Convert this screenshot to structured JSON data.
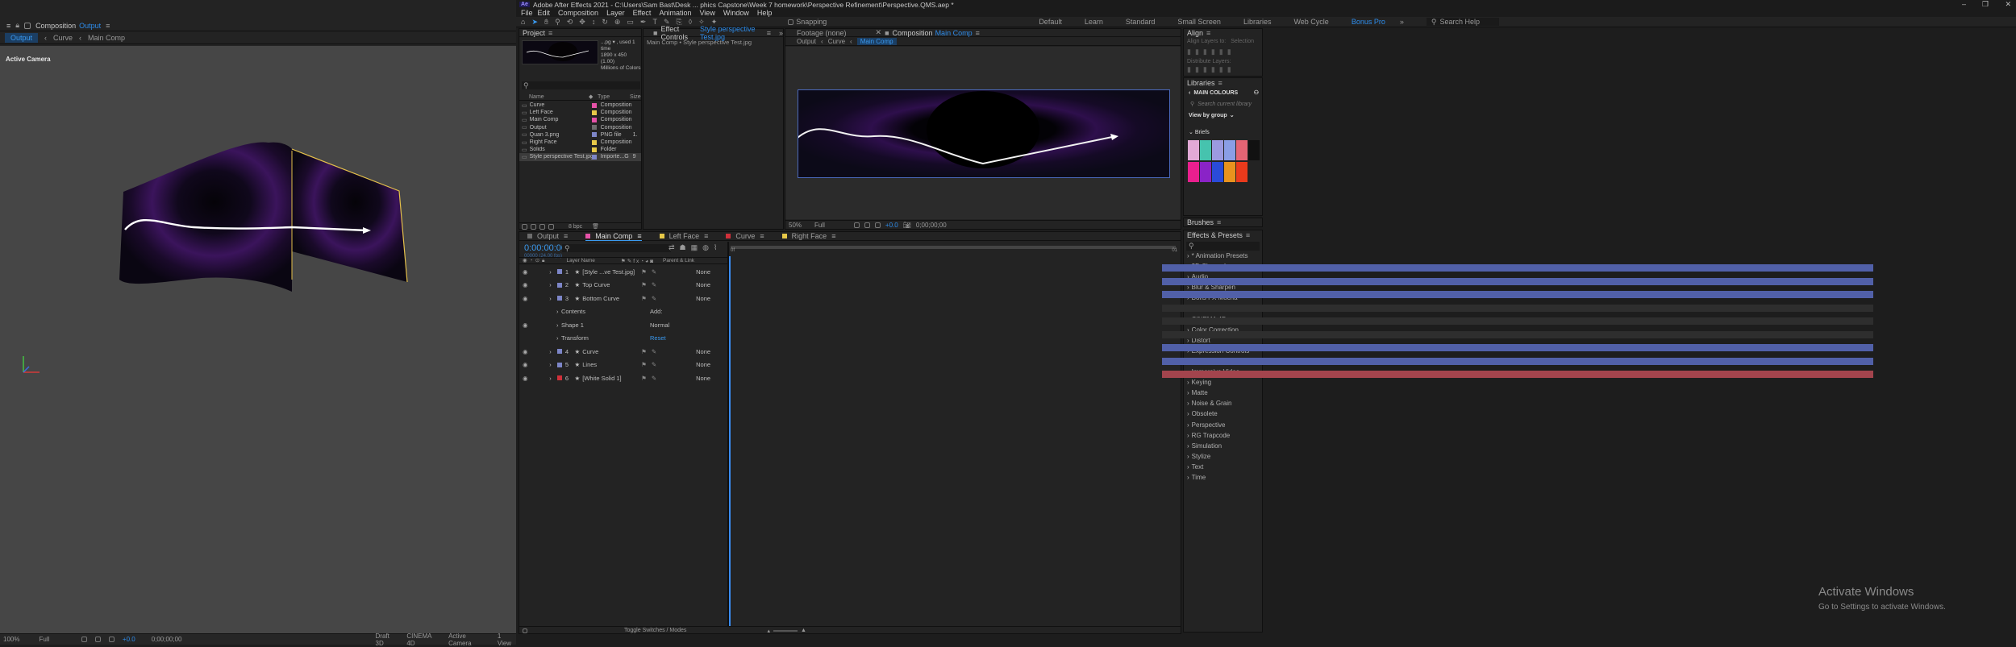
{
  "left_viewer": {
    "title": "Composition",
    "active": "Output",
    "tabs": [
      "Output",
      "Curve",
      "Main Comp"
    ],
    "camera_label": "Active Camera",
    "status": {
      "zoom": "100%",
      "quality": "Full",
      "exposure": "+0.0",
      "timecode": "0;00;00;00",
      "renderer": "Draft 3D",
      "engine": "CINEMA 4D",
      "camera": "Active Camera",
      "views": "1 View"
    }
  },
  "app": {
    "logo": "Ae",
    "title": "Adobe After Effects 2021 - C:\\Users\\Sam Bast\\Desk ... phics Capstone\\Week 7 homework\\Perspective Refinement\\Perspective.QMS.aep *"
  },
  "menu": [
    "File",
    "Edit",
    "Composition",
    "Layer",
    "Effect",
    "Animation",
    "View",
    "Window",
    "Help"
  ],
  "toolbar": {
    "snapping": "Snapping",
    "workspaces": [
      "Default",
      "Learn",
      "Standard",
      "Small Screen",
      "Libraries",
      "Web Cycle",
      "Bonus Pro"
    ],
    "search": "Search Help"
  },
  "project": {
    "tab": "Project",
    "preview_info": [
      "...pg ▾ , used 1 time",
      "1890 x 450 (1.00)",
      "",
      "Millions of Colors"
    ],
    "headers": [
      "Name",
      "Type",
      "Size"
    ],
    "items": [
      {
        "name": "Curve",
        "type": "Composition",
        "size": "",
        "color": "#e652a8"
      },
      {
        "name": "Left Face",
        "type": "Composition",
        "size": "",
        "color": "#e6c848"
      },
      {
        "name": "Main Comp",
        "type": "Composition",
        "size": "",
        "color": "#e652a8"
      },
      {
        "name": "Output",
        "type": "Composition",
        "size": "",
        "color": "#6d6d6d"
      },
      {
        "name": "Quan 3.png",
        "type": "PNG file",
        "size": "1.",
        "color": "#7d86c8"
      },
      {
        "name": "Right Face",
        "type": "Composition",
        "size": "",
        "color": "#e6c848"
      },
      {
        "name": "Solids",
        "type": "Folder",
        "size": "",
        "color": "#e6c848"
      },
      {
        "name": "Style perspective Test.jpg",
        "type": "Importe...G",
        "size": "9",
        "color": "#7d86c8"
      }
    ],
    "footer": "8 bpc"
  },
  "effect_controls": {
    "tab": "Effect Controls",
    "file": "Style perspective Test.jpg",
    "sub": "Main Comp • Style perspective Test.jpg"
  },
  "comp_viewer": {
    "footage_tab": "Footage (none)",
    "comp_tab": "Composition",
    "comp_name": "Main Comp",
    "crumbs": [
      "Output",
      "Curve",
      "Main Comp"
    ],
    "zoom": "50%",
    "quality": "Full",
    "exposure": "+0.0",
    "timecode": "0;00;00;00"
  },
  "align": {
    "title": "Align",
    "align_layers": "Align Layers to:",
    "selection": "Selection",
    "distribute": "Distribute Layers:"
  },
  "libraries": {
    "title": "Libraries",
    "library": "MAIN COLOURS",
    "search": "Search current library",
    "view": "View by group",
    "group": "Briefs",
    "colors_row1": [
      "#e2a9d6",
      "#46c3ae",
      "#9c9ae0",
      "#8a9ee6",
      "#e46474",
      "#111111"
    ],
    "colors_row2": [
      "#ea1f8e",
      "#8a23c7",
      "#2a4bd9",
      "#e8931e",
      "#ea3a1c"
    ]
  },
  "brushes": "Brushes",
  "effects": {
    "title": "Effects & Presets",
    "items": [
      "* Animation Presets",
      "3D Channel",
      "Audio",
      "Blur & Sharpen",
      "Boris FX Mocha",
      "Channel",
      "CINEMA 4D",
      "Color Correction",
      "Distort",
      "Expression Controls",
      "Generate",
      "Immersive Video",
      "Keying",
      "Matte",
      "Noise & Grain",
      "Obsolete",
      "Perspective",
      "RG Trapcode",
      "Simulation",
      "Stylize",
      "Text",
      "Time"
    ]
  },
  "timeline": {
    "tabs": [
      {
        "label": "Output",
        "color": "#6d6d6d"
      },
      {
        "label": "Main Comp",
        "color": "#e652a8"
      },
      {
        "label": "Left Face",
        "color": "#e6c848"
      },
      {
        "label": "Curve",
        "color": "#d0303a"
      },
      {
        "label": "Right Face",
        "color": "#e6c848"
      }
    ],
    "timecode": "0:00:00:00",
    "fps": "00000 (24.00 fps)",
    "col_layer": "Layer Name",
    "col_parent": "Parent & Link",
    "ruler_start": "0f",
    "ruler_end": "01",
    "layers": [
      {
        "num": "1",
        "name": "[Style ...ve Test.jpg]",
        "parent": "None",
        "color": "#7d86c8"
      },
      {
        "num": "2",
        "name": "Top Curve",
        "parent": "None",
        "color": "#7d86c8"
      },
      {
        "num": "3",
        "name": "Bottom Curve",
        "parent": "None",
        "color": "#7d86c8"
      },
      {
        "num": "",
        "name": "Contents",
        "parent": "",
        "color": ""
      },
      {
        "num": "",
        "name": "Shape 1",
        "parent": "Normal",
        "color": ""
      },
      {
        "num": "",
        "name": "Transform",
        "parent": "Reset",
        "color": ""
      },
      {
        "num": "4",
        "name": "Curve",
        "parent": "None",
        "color": "#7d86c8"
      },
      {
        "num": "5",
        "name": "Lines",
        "parent": "None",
        "color": "#7d86c8"
      },
      {
        "num": "6",
        "name": "[White Solid 1]",
        "parent": "None",
        "color": "#d0303a"
      }
    ],
    "add": "Add:",
    "toggle": "Toggle Switches / Modes"
  },
  "watermark": {
    "line1": "Activate Windows",
    "line2": "Go to Settings to activate Windows."
  }
}
